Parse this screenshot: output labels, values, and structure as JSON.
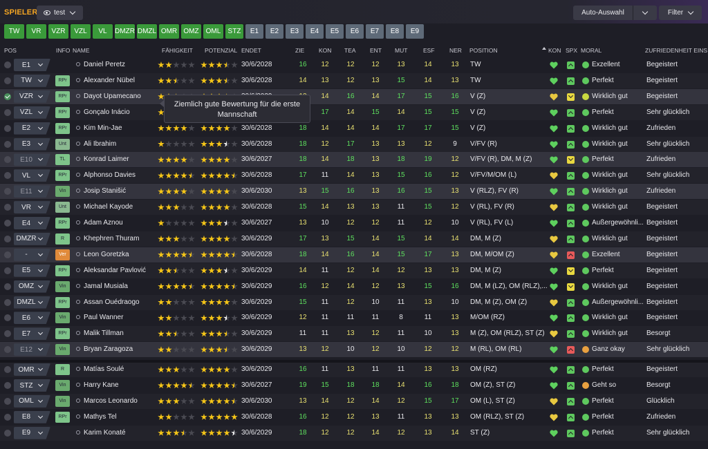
{
  "header": {
    "title": "SPIELER",
    "view_label": "test",
    "auto_label": "Auto-Auswahl",
    "filter_label": "Filter"
  },
  "position_filters": [
    {
      "label": "TW",
      "active": true
    },
    {
      "label": "VR",
      "active": true
    },
    {
      "label": "VZR",
      "active": true
    },
    {
      "label": "VZL",
      "active": true
    },
    {
      "label": "VL",
      "active": true
    },
    {
      "label": "DMZR",
      "active": true
    },
    {
      "label": "DMZL",
      "active": true
    },
    {
      "label": "OMR",
      "active": true
    },
    {
      "label": "OMZ",
      "active": true
    },
    {
      "label": "OML",
      "active": true
    },
    {
      "label": "STZ",
      "active": true
    },
    {
      "label": "E1",
      "active": false
    },
    {
      "label": "E2",
      "active": false
    },
    {
      "label": "E3",
      "active": false
    },
    {
      "label": "E4",
      "active": false
    },
    {
      "label": "E5",
      "active": false
    },
    {
      "label": "E6",
      "active": false
    },
    {
      "label": "E7",
      "active": false
    },
    {
      "label": "E8",
      "active": false
    },
    {
      "label": "E9",
      "active": false
    }
  ],
  "columns": {
    "pos": "POS",
    "info": "INFO",
    "name": "NAME",
    "ability": "FÄHIGKEIT",
    "potential": "POTENZIAL",
    "ends": "ENDET",
    "zie": "ZIE",
    "kon": "KON",
    "tea": "TEA",
    "ent": "ENT",
    "mut": "MUT",
    "esf": "ESF",
    "ner": "NER",
    "position": "POSITION",
    "kon2": "KON",
    "spx": "SPX",
    "morale": "MORAL",
    "satisfaction": "ZUFRIEDENHEIT EINS"
  },
  "tooltip": {
    "line1": "Ziemlich gute Bewertung für die erste",
    "line2": "Mannschaft"
  },
  "players": [
    {
      "pos": "E1",
      "info": "",
      "name": "Daniel Peretz",
      "fa": 2,
      "pa": 3.5,
      "pa_white": false,
      "ends": "30/6/2028",
      "zie": "16",
      "kon": "12",
      "tea": "12",
      "ent": "12",
      "mut": "13",
      "esf": "14",
      "ner": "13",
      "position": "TW",
      "morale": "Exzellent",
      "sat": "Begeistert",
      "heart": "green",
      "spx": "green",
      "mood": "g",
      "chk": false
    },
    {
      "pos": "TW",
      "info": "RPr",
      "name": "Alexander Nübel",
      "fa": 2.5,
      "pa": 3.5,
      "pa_white": false,
      "ends": "30/6/2028",
      "zie": "14",
      "kon": "13",
      "tea": "12",
      "ent": "13",
      "mut": "15",
      "esf": "14",
      "ner": "13",
      "position": "TW",
      "morale": "Perfekt",
      "sat": "Begeistert",
      "heart": "green",
      "spx": "green",
      "mood": "g",
      "chk": false
    },
    {
      "pos": "VZR",
      "info": "RPr",
      "name": "Dayot Upamecano",
      "fa": 2.5,
      "pa": 3.5,
      "pa_white": false,
      "ends": "30/6/2029",
      "zie": "13",
      "kon": "14",
      "tea": "16",
      "ent": "14",
      "mut": "17",
      "esf": "15",
      "ner": "16",
      "position": "V (Z)",
      "morale": "Wirklich gut",
      "sat": "Begeistert",
      "heart": "yellow",
      "spx": "yellow",
      "mood": "y",
      "chk": true
    },
    {
      "pos": "VZL",
      "info": "RPr",
      "name": "Gonçalo Inácio",
      "fa": 2.5,
      "pa": 3.5,
      "pa_white": false,
      "ends": "30/6/2029",
      "zie": "15",
      "kon": "17",
      "tea": "14",
      "ent": "15",
      "mut": "14",
      "esf": "15",
      "ner": "15",
      "position": "V (Z)",
      "morale": "Perfekt",
      "sat": "Sehr glücklich",
      "heart": "green",
      "spx": "green",
      "mood": "g",
      "chk": false
    },
    {
      "pos": "E2",
      "info": "RPr",
      "name": "Kim Min-Jae",
      "fa": 4,
      "pa": 4,
      "pa_white": false,
      "ends": "30/6/2028",
      "zie": "18",
      "kon": "14",
      "tea": "14",
      "ent": "14",
      "mut": "17",
      "esf": "17",
      "ner": "15",
      "position": "V (Z)",
      "morale": "Wirklich gut",
      "sat": "Zufrieden",
      "heart": "green",
      "spx": "green",
      "mood": "g",
      "chk": false
    },
    {
      "pos": "E3",
      "info": "Unt",
      "name": "Ali Ibrahim",
      "fa": 1,
      "pa": 3.5,
      "pa_white": true,
      "ends": "30/6/2028",
      "zie": "18",
      "kon": "12",
      "tea": "17",
      "ent": "13",
      "mut": "13",
      "esf": "12",
      "ner": "9",
      "position": "V/FV (R)",
      "morale": "Wirklich gut",
      "sat": "Sehr glücklich",
      "heart": "green",
      "spx": "green",
      "mood": "g",
      "chk": false
    },
    {
      "pos": "E10",
      "info": "TL",
      "name": "Konrad Laimer",
      "fa": 4,
      "pa": 4,
      "pa_white": false,
      "ends": "30/6/2027",
      "zie": "18",
      "kon": "14",
      "tea": "18",
      "ent": "13",
      "mut": "18",
      "esf": "19",
      "ner": "12",
      "position": "V/FV (R), DM, M (Z)",
      "morale": "Perfekt",
      "sat": "Zufrieden",
      "heart": "green",
      "spx": "yellow",
      "mood": "g",
      "chk": false
    },
    {
      "pos": "VL",
      "info": "RPr",
      "name": "Alphonso Davies",
      "fa": 4.5,
      "pa": 4.5,
      "pa_white": false,
      "ends": "30/6/2028",
      "zie": "17",
      "kon": "11",
      "tea": "14",
      "ent": "13",
      "mut": "15",
      "esf": "16",
      "ner": "12",
      "position": "V/FV/M/OM (L)",
      "morale": "Wirklich gut",
      "sat": "Sehr glücklich",
      "heart": "yellow",
      "spx": "green",
      "mood": "g",
      "chk": false
    },
    {
      "pos": "E11",
      "info": "Vin",
      "name": "Josip Stanišić",
      "fa": 4,
      "pa": 4,
      "pa_white": false,
      "ends": "30/6/2030",
      "zie": "13",
      "kon": "15",
      "tea": "16",
      "ent": "13",
      "mut": "16",
      "esf": "15",
      "ner": "13",
      "position": "V (RLZ), FV (R)",
      "morale": "Wirklich gut",
      "sat": "Zufrieden",
      "heart": "green",
      "spx": "green",
      "mood": "g",
      "chk": false
    },
    {
      "pos": "VR",
      "info": "Unt",
      "name": "Michael Kayode",
      "fa": 3,
      "pa": 4,
      "pa_white": true,
      "ends": "30/6/2028",
      "zie": "15",
      "kon": "14",
      "tea": "13",
      "ent": "13",
      "mut": "11",
      "esf": "15",
      "ner": "12",
      "position": "V (RL), FV (R)",
      "morale": "Wirklich gut",
      "sat": "Begeistert",
      "heart": "yellow",
      "spx": "green",
      "mood": "g",
      "chk": false
    },
    {
      "pos": "E4",
      "info": "RPr",
      "name": "Adam Aznou",
      "fa": 1,
      "pa": 3.5,
      "pa_white": true,
      "ends": "30/6/2027",
      "zie": "13",
      "kon": "10",
      "tea": "12",
      "ent": "12",
      "mut": "11",
      "esf": "12",
      "ner": "10",
      "position": "V (RL), FV (L)",
      "morale": "Außergewöhnli...",
      "sat": "Begeistert",
      "heart": "green",
      "spx": "green",
      "mood": "g",
      "chk": false
    },
    {
      "pos": "DMZR",
      "info": "R",
      "name": "Khephren Thuram",
      "fa": 3,
      "pa": 4,
      "pa_white": false,
      "ends": "30/6/2029",
      "zie": "17",
      "kon": "13",
      "tea": "15",
      "ent": "14",
      "mut": "15",
      "esf": "14",
      "ner": "14",
      "position": "DM, M (Z)",
      "morale": "Wirklich gut",
      "sat": "Begeistert",
      "heart": "yellow",
      "spx": "green",
      "mood": "g",
      "chk": false
    },
    {
      "pos": "-",
      "info": "Ver",
      "name": "Leon Goretzka",
      "fa": 4.5,
      "pa": 4.5,
      "pa_white": false,
      "ends": "30/6/2028",
      "zie": "18",
      "kon": "14",
      "tea": "16",
      "ent": "14",
      "mut": "15",
      "esf": "17",
      "ner": "13",
      "position": "DM, M/OM (Z)",
      "morale": "Exzellent",
      "sat": "Begeistert",
      "heart": "yellow",
      "spx": "red",
      "mood": "g",
      "chk": false
    },
    {
      "pos": "E5",
      "info": "RPr",
      "name": "Aleksandar Pavlović",
      "fa": 2.5,
      "pa": 3.5,
      "pa_white": true,
      "ends": "30/6/2029",
      "zie": "14",
      "kon": "11",
      "tea": "12",
      "ent": "14",
      "mut": "12",
      "esf": "13",
      "ner": "13",
      "position": "DM, M (Z)",
      "morale": "Perfekt",
      "sat": "Begeistert",
      "heart": "green",
      "spx": "yellow",
      "mood": "g",
      "chk": false
    },
    {
      "pos": "OMZ",
      "info": "Vin",
      "name": "Jamal Musiala",
      "fa": 4.5,
      "pa": 4.5,
      "pa_white": false,
      "ends": "30/6/2029",
      "zie": "16",
      "kon": "12",
      "tea": "14",
      "ent": "12",
      "mut": "13",
      "esf": "15",
      "ner": "16",
      "position": "DM, M (LZ), OM (RLZ),...",
      "morale": "Wirklich gut",
      "sat": "Begeistert",
      "heart": "green",
      "spx": "yellow",
      "mood": "g",
      "chk": false
    },
    {
      "pos": "DMZL",
      "info": "RPr",
      "name": "Assan Ouédraogo",
      "fa": 2,
      "pa": 4,
      "pa_white": true,
      "ends": "30/6/2029",
      "zie": "15",
      "kon": "11",
      "tea": "12",
      "ent": "10",
      "mut": "11",
      "esf": "13",
      "ner": "10",
      "position": "DM, M (Z), OM (Z)",
      "morale": "Außergewöhnli...",
      "sat": "Begeistert",
      "heart": "yellow",
      "spx": "green",
      "mood": "g",
      "chk": false
    },
    {
      "pos": "E6",
      "info": "Vin",
      "name": "Paul Wanner",
      "fa": 2,
      "pa": 3.5,
      "pa_white": true,
      "ends": "30/6/2029",
      "zie": "12",
      "kon": "11",
      "tea": "11",
      "ent": "11",
      "mut": "8",
      "esf": "11",
      "ner": "13",
      "position": "M/OM (RZ)",
      "morale": "Wirklich gut",
      "sat": "Begeistert",
      "heart": "green",
      "spx": "green",
      "mood": "g",
      "chk": false
    },
    {
      "pos": "E7",
      "info": "RPr",
      "name": "Malik Tillman",
      "fa": 2.5,
      "pa": 3.5,
      "pa_white": false,
      "ends": "30/6/2029",
      "zie": "11",
      "kon": "11",
      "tea": "13",
      "ent": "12",
      "mut": "11",
      "esf": "10",
      "ner": "13",
      "position": "M (Z), OM (RLZ), ST (Z)",
      "morale": "Wirklich gut",
      "sat": "Besorgt",
      "heart": "yellow",
      "spx": "green",
      "mood": "g",
      "chk": false
    },
    {
      "pos": "E12",
      "info": "Vin",
      "name": "Bryan Zaragoza",
      "fa": 2,
      "pa": 3.5,
      "pa_white": false,
      "ends": "30/6/2029",
      "zie": "13",
      "kon": "12",
      "tea": "10",
      "ent": "12",
      "mut": "10",
      "esf": "12",
      "ner": "12",
      "position": "M (RL), OM (RL)",
      "morale": "Ganz okay",
      "sat": "Sehr glücklich",
      "heart": "green",
      "spx": "red",
      "mood": "o",
      "chk": false
    },
    {
      "pos": "OMR",
      "info": "R",
      "name": "Matías Soulé",
      "fa": 3,
      "pa": 4,
      "pa_white": false,
      "ends": "30/6/2029",
      "zie": "16",
      "kon": "11",
      "tea": "13",
      "ent": "11",
      "mut": "11",
      "esf": "13",
      "ner": "13",
      "position": "OM (RZ)",
      "morale": "Perfekt",
      "sat": "Begeistert",
      "heart": "green",
      "spx": "green",
      "mood": "g",
      "chk": false
    },
    {
      "pos": "STZ",
      "info": "Vin",
      "name": "Harry Kane",
      "fa": 4.5,
      "pa": 4.5,
      "pa_white": false,
      "ends": "30/6/2027",
      "zie": "19",
      "kon": "15",
      "tea": "18",
      "ent": "18",
      "mut": "14",
      "esf": "16",
      "ner": "18",
      "position": "OM (Z), ST (Z)",
      "morale": "Geht so",
      "sat": "Besorgt",
      "heart": "green",
      "spx": "green",
      "mood": "o",
      "chk": false
    },
    {
      "pos": "OML",
      "info": "Vin",
      "name": "Marcos Leonardo",
      "fa": 3,
      "pa": 4.5,
      "pa_white": false,
      "ends": "30/6/2030",
      "zie": "13",
      "kon": "14",
      "tea": "12",
      "ent": "14",
      "mut": "12",
      "esf": "15",
      "ner": "17",
      "position": "OM (L), ST (Z)",
      "morale": "Perfekt",
      "sat": "Glücklich",
      "heart": "yellow",
      "spx": "green",
      "mood": "g",
      "chk": false
    },
    {
      "pos": "E8",
      "info": "RPr",
      "name": "Mathys Tel",
      "fa": 2,
      "pa": 5,
      "pa_white": true,
      "ends": "30/6/2028",
      "zie": "16",
      "kon": "12",
      "tea": "12",
      "ent": "13",
      "mut": "11",
      "esf": "13",
      "ner": "13",
      "position": "OM (RLZ), ST (Z)",
      "morale": "Perfekt",
      "sat": "Zufrieden",
      "heart": "yellow",
      "spx": "green",
      "mood": "g",
      "chk": false
    },
    {
      "pos": "E9",
      "info": "",
      "name": "Karim Konaté",
      "fa": 3.5,
      "pa": 4.5,
      "pa_white": true,
      "ends": "30/6/2029",
      "zie": "18",
      "kon": "12",
      "tea": "12",
      "ent": "14",
      "mut": "12",
      "esf": "13",
      "ner": "14",
      "position": "ST (Z)",
      "morale": "Perfekt",
      "sat": "Sehr glücklich",
      "heart": "green",
      "spx": "green",
      "mood": "g",
      "chk": false
    }
  ]
}
